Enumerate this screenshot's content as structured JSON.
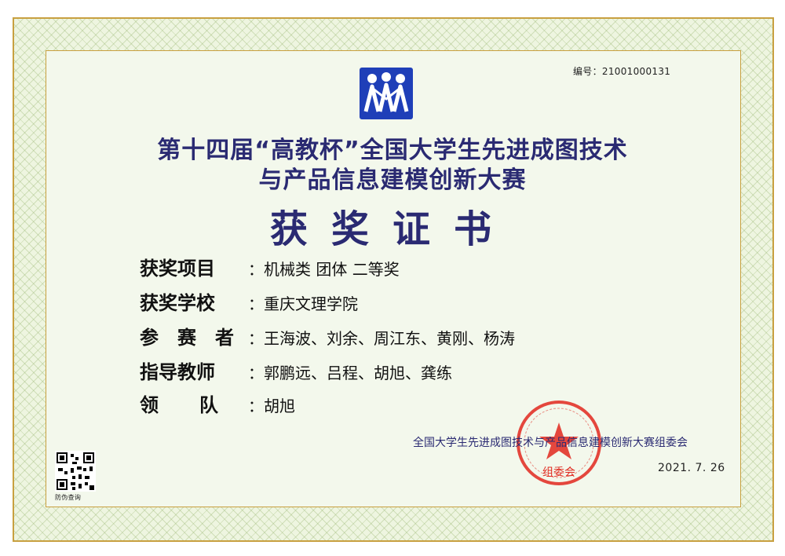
{
  "certificate": {
    "serial": "编号：21001000131",
    "title_line1": "第十四届“高教杯”全国大学生先进成图技术",
    "title_line2": "与产品信息建模创新大赛",
    "heading": "获奖证书",
    "award_label": "获奖项目",
    "award_value": "：机械类  团体  二等奖",
    "school_label": "获奖学校",
    "school_value": "：重庆文理学院",
    "participants_label": "参赛者",
    "participants_value": "：王海波、刘余、周江东、黄刚、杨涛",
    "advisors_label": "指导教师",
    "advisors_value": "：郭鹏远、吕程、胡旭、龚练",
    "leader_label": "领队",
    "leader_value": "：胡旭",
    "organizer": "全国大学生先进成图技术与产品信息建模创新大赛组委会",
    "date": "2021. 7. 26",
    "seal_text": "组委会",
    "qr_caption": "防伪查询"
  },
  "colors": {
    "title": "#2a2a72",
    "logo_blue": "#1f3fb8",
    "seal_red": "#e0281e",
    "border_gold": "#c8a040"
  }
}
